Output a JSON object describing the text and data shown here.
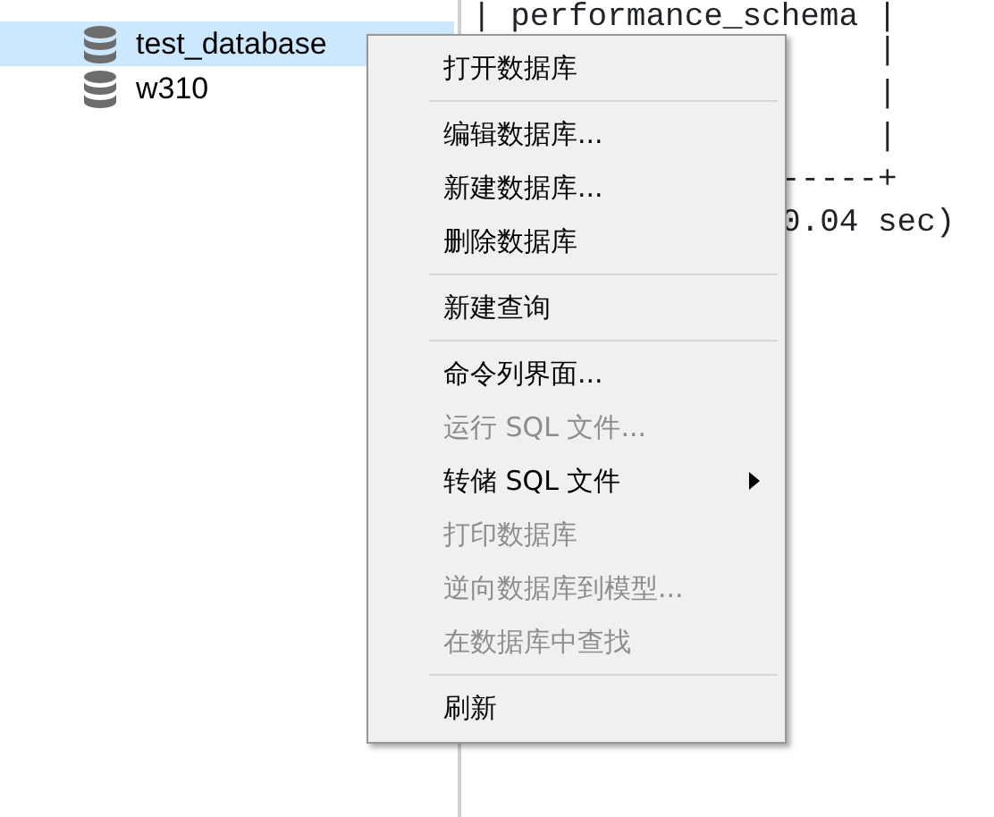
{
  "tree": {
    "items": [
      {
        "label": "test_database",
        "selected": true
      },
      {
        "label": "w310",
        "selected": false
      }
    ]
  },
  "console": {
    "lines": [
      {
        "kind": "row",
        "text": "| performance_schema |"
      },
      {
        "kind": "border",
        "text": "|"
      },
      {
        "kind": "border",
        "text": "|"
      },
      {
        "kind": "border",
        "text": "|"
      },
      {
        "kind": "rule",
        "text": "-----+"
      },
      {
        "kind": "summary",
        "text": "0.04 sec)"
      }
    ]
  },
  "context_menu": {
    "items": [
      {
        "kind": "item",
        "label": "打开数据库",
        "disabled": false,
        "submenu": false
      },
      {
        "kind": "separator"
      },
      {
        "kind": "item",
        "label": "编辑数据库...",
        "disabled": false,
        "submenu": false
      },
      {
        "kind": "item",
        "label": "新建数据库...",
        "disabled": false,
        "submenu": false
      },
      {
        "kind": "item",
        "label": "删除数据库",
        "disabled": false,
        "submenu": false
      },
      {
        "kind": "separator"
      },
      {
        "kind": "item",
        "label": "新建查询",
        "disabled": false,
        "submenu": false
      },
      {
        "kind": "separator"
      },
      {
        "kind": "item",
        "label": "命令列界面...",
        "disabled": false,
        "submenu": false
      },
      {
        "kind": "item",
        "label": "运行 SQL 文件...",
        "disabled": true,
        "submenu": false
      },
      {
        "kind": "item",
        "label": "转储 SQL 文件",
        "disabled": false,
        "submenu": true
      },
      {
        "kind": "item",
        "label": "打印数据库",
        "disabled": true,
        "submenu": false
      },
      {
        "kind": "item",
        "label": "逆向数据库到模型...",
        "disabled": true,
        "submenu": false
      },
      {
        "kind": "item",
        "label": "在数据库中查找",
        "disabled": true,
        "submenu": false
      },
      {
        "kind": "separator"
      },
      {
        "kind": "item",
        "label": "刷新",
        "disabled": false,
        "submenu": false
      }
    ]
  }
}
